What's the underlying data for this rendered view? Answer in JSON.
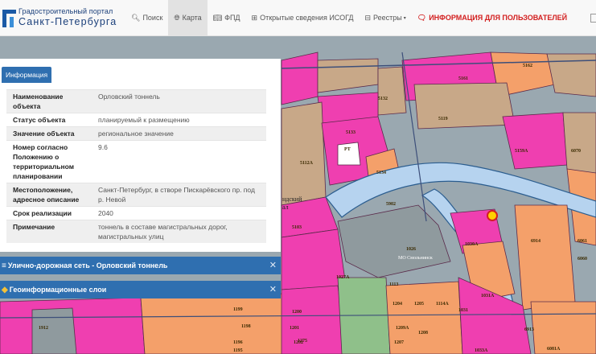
{
  "brand": {
    "line1": "Градостроительный портал",
    "line2": "Санкт-Петербурга"
  },
  "nav": {
    "search": "Поиск",
    "map": "Карта",
    "fpd": "ФПД",
    "isogd": "Открытые сведения ИСОГД",
    "registries": "Реестры",
    "info_for_users": "ИНФОРМАЦИЯ ДЛЯ ПОЛЬЗОВАТЕЛЕЙ"
  },
  "info_panel": {
    "tab_label": "Информация",
    "rows": [
      {
        "key": "Наименование объекта",
        "value": "Орловский тоннель"
      },
      {
        "key": "Статус объекта",
        "value": "планируемый к размещению"
      },
      {
        "key": "Значение объекта",
        "value": "региональное значение"
      },
      {
        "key": "Номер согласно Положению о территориальном планировании",
        "value": "9.6"
      },
      {
        "key": "Местоположение, адресное описание",
        "value": "Санкт-Петербург, в створе Пискарёвского пр. под р. Невой"
      },
      {
        "key": "Срок реализации",
        "value": "2040"
      },
      {
        "key": "Примечание",
        "value": "тоннель в составе магистральных дорог, магистральных улиц"
      }
    ]
  },
  "panels": {
    "roads_title": "Улично-дорожная сеть - Орловский тоннель",
    "layers_title": "Геоинформационные слои"
  },
  "map_labels": {
    "labels": [
      "5161",
      "5162",
      "5132",
      "5119",
      "5133",
      "РТ",
      "5112A",
      "5134",
      "5159A",
      "6070",
      "5902",
      "5103",
      "1026",
      "МО Смольнинск",
      "1030A",
      "6914",
      "6061",
      "6060",
      "1027A",
      "1113",
      "1204",
      "1205",
      "1114A",
      "1031A",
      "1031",
      "1199",
      "1200",
      "1198",
      "1201",
      "1202",
      "1207",
      "1208",
      "1209A",
      "1912",
      "1196",
      "1195",
      "1275",
      "1033A",
      "6913",
      "6081A",
      "ндский",
      "ал"
    ]
  },
  "icons": {
    "search": "search-icon",
    "map": "globe-icon",
    "fpd": "book-icon",
    "isogd": "plus-square-icon",
    "registries": "grid-icon",
    "info": "chat-icon",
    "roads": "menu-icon",
    "layers": "layers-icon",
    "close": "close-icon"
  },
  "colors": {
    "panel_blue": "#2f6fb0",
    "alert_red": "#d32020",
    "brand_blue": "#1b5aa6",
    "zone_pink": "#ef3fb0",
    "zone_brown": "#c8a888",
    "zone_orange": "#f4a06a",
    "river": "#b6d3ef"
  }
}
